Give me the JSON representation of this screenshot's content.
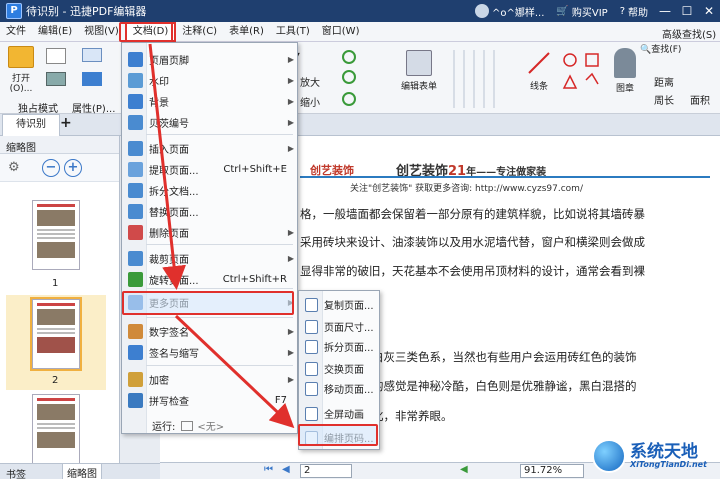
{
  "app": {
    "title": "待识别 - 迅捷PDF编辑器",
    "user_name": "^o^娜样...",
    "vip_label": "购买VIP",
    "help_label": "帮助"
  },
  "menubar": [
    "文件",
    "编辑(E)",
    "视图(V)",
    "文档(D)",
    "注释(C)",
    "表单(R)",
    "工具(T)",
    "窗口(W)"
  ],
  "ribbon": {
    "open_label": "打开(O)...",
    "exclusive_mode": "独占模式",
    "properties": "属性(P)...",
    "page_dropdown": "%",
    "zoom_in": "放大",
    "zoom_out": "缩小",
    "edit_form": "编辑表单",
    "lines": "线条",
    "stamp": "图章",
    "find": "查找(F)",
    "adv_find": "高级查找(S)",
    "distance": "距离",
    "perimeter": "周长",
    "area": "面积"
  },
  "tabs": {
    "doc_tab": "待识别",
    "panel_title": "缩略图",
    "bottom_left": "书签",
    "bottom_right": "缩略图"
  },
  "thumbs": {
    "page1": "1",
    "page2": "2"
  },
  "doc_menu": {
    "items": [
      {
        "label": "页眉页脚",
        "shortcut": "",
        "arrow": "▶"
      },
      {
        "label": "水印",
        "shortcut": "",
        "arrow": "▶"
      },
      {
        "label": "背景",
        "shortcut": "",
        "arrow": "▶"
      },
      {
        "label": "贝茨编号",
        "shortcut": "",
        "arrow": "▶"
      },
      {
        "label": "插入页面",
        "shortcut": "",
        "arrow": "▶"
      },
      {
        "label": "提取页面...",
        "shortcut": "Ctrl+Shift+E",
        "arrow": ""
      },
      {
        "label": "拆分文档...",
        "shortcut": "",
        "arrow": ""
      },
      {
        "label": "替换页面...",
        "shortcut": "",
        "arrow": ""
      },
      {
        "label": "删除页面",
        "shortcut": "",
        "arrow": "▶"
      },
      {
        "label": "裁剪页面",
        "shortcut": "",
        "arrow": "▶"
      },
      {
        "label": "旋转页面...",
        "shortcut": "Ctrl+Shift+R",
        "arrow": ""
      },
      {
        "label": "更多页面",
        "shortcut": "",
        "arrow": "▶"
      },
      {
        "label": "数字签名",
        "shortcut": "",
        "arrow": "▶"
      },
      {
        "label": "签名与缩写",
        "shortcut": "",
        "arrow": "▶"
      },
      {
        "label": "加密",
        "shortcut": "",
        "arrow": "▶"
      },
      {
        "label": "拼写检查",
        "shortcut": "F7",
        "arrow": ""
      }
    ],
    "run_label": "运行:",
    "run_value": "<无>"
  },
  "more_pages_menu": {
    "items": [
      "复制页面...",
      "页面尺寸...",
      "拆分页面...",
      "交换页面",
      "移动页面...",
      "全屏动画",
      "编排页码..."
    ]
  },
  "document": {
    "brand_left": "创艺装饰",
    "header_title": "创艺装饰",
    "header_num": "21",
    "header_tail": "年——专注做家装",
    "sub_line": "关注\"创艺装饰\" 获取更多咨询: http://www.cyzs97.com/",
    "lines": [
      "格，一般墙面都会保留着一部分原有的建筑样貌，比如说将其墙砖暴",
      "采用砖块来设计、油漆装饰以及用水泥墙代替，窗户和横梁则会做成",
      "显得非常的破旧，天花基本不会使用吊顶材料的设计，通常会看到裸",
      "白灰三类色系，当然也有些用户会运用砖红色的装饰",
      "的感觉是神秘冷酷，白色则是优雅静谧，黑白混搭的",
      "化，非常养眼。"
    ]
  },
  "statusbar": {
    "page_current": "2",
    "zoom": "91.72%"
  },
  "watermark": {
    "title": "系统天地",
    "url": "XiTongTianDi.net"
  }
}
